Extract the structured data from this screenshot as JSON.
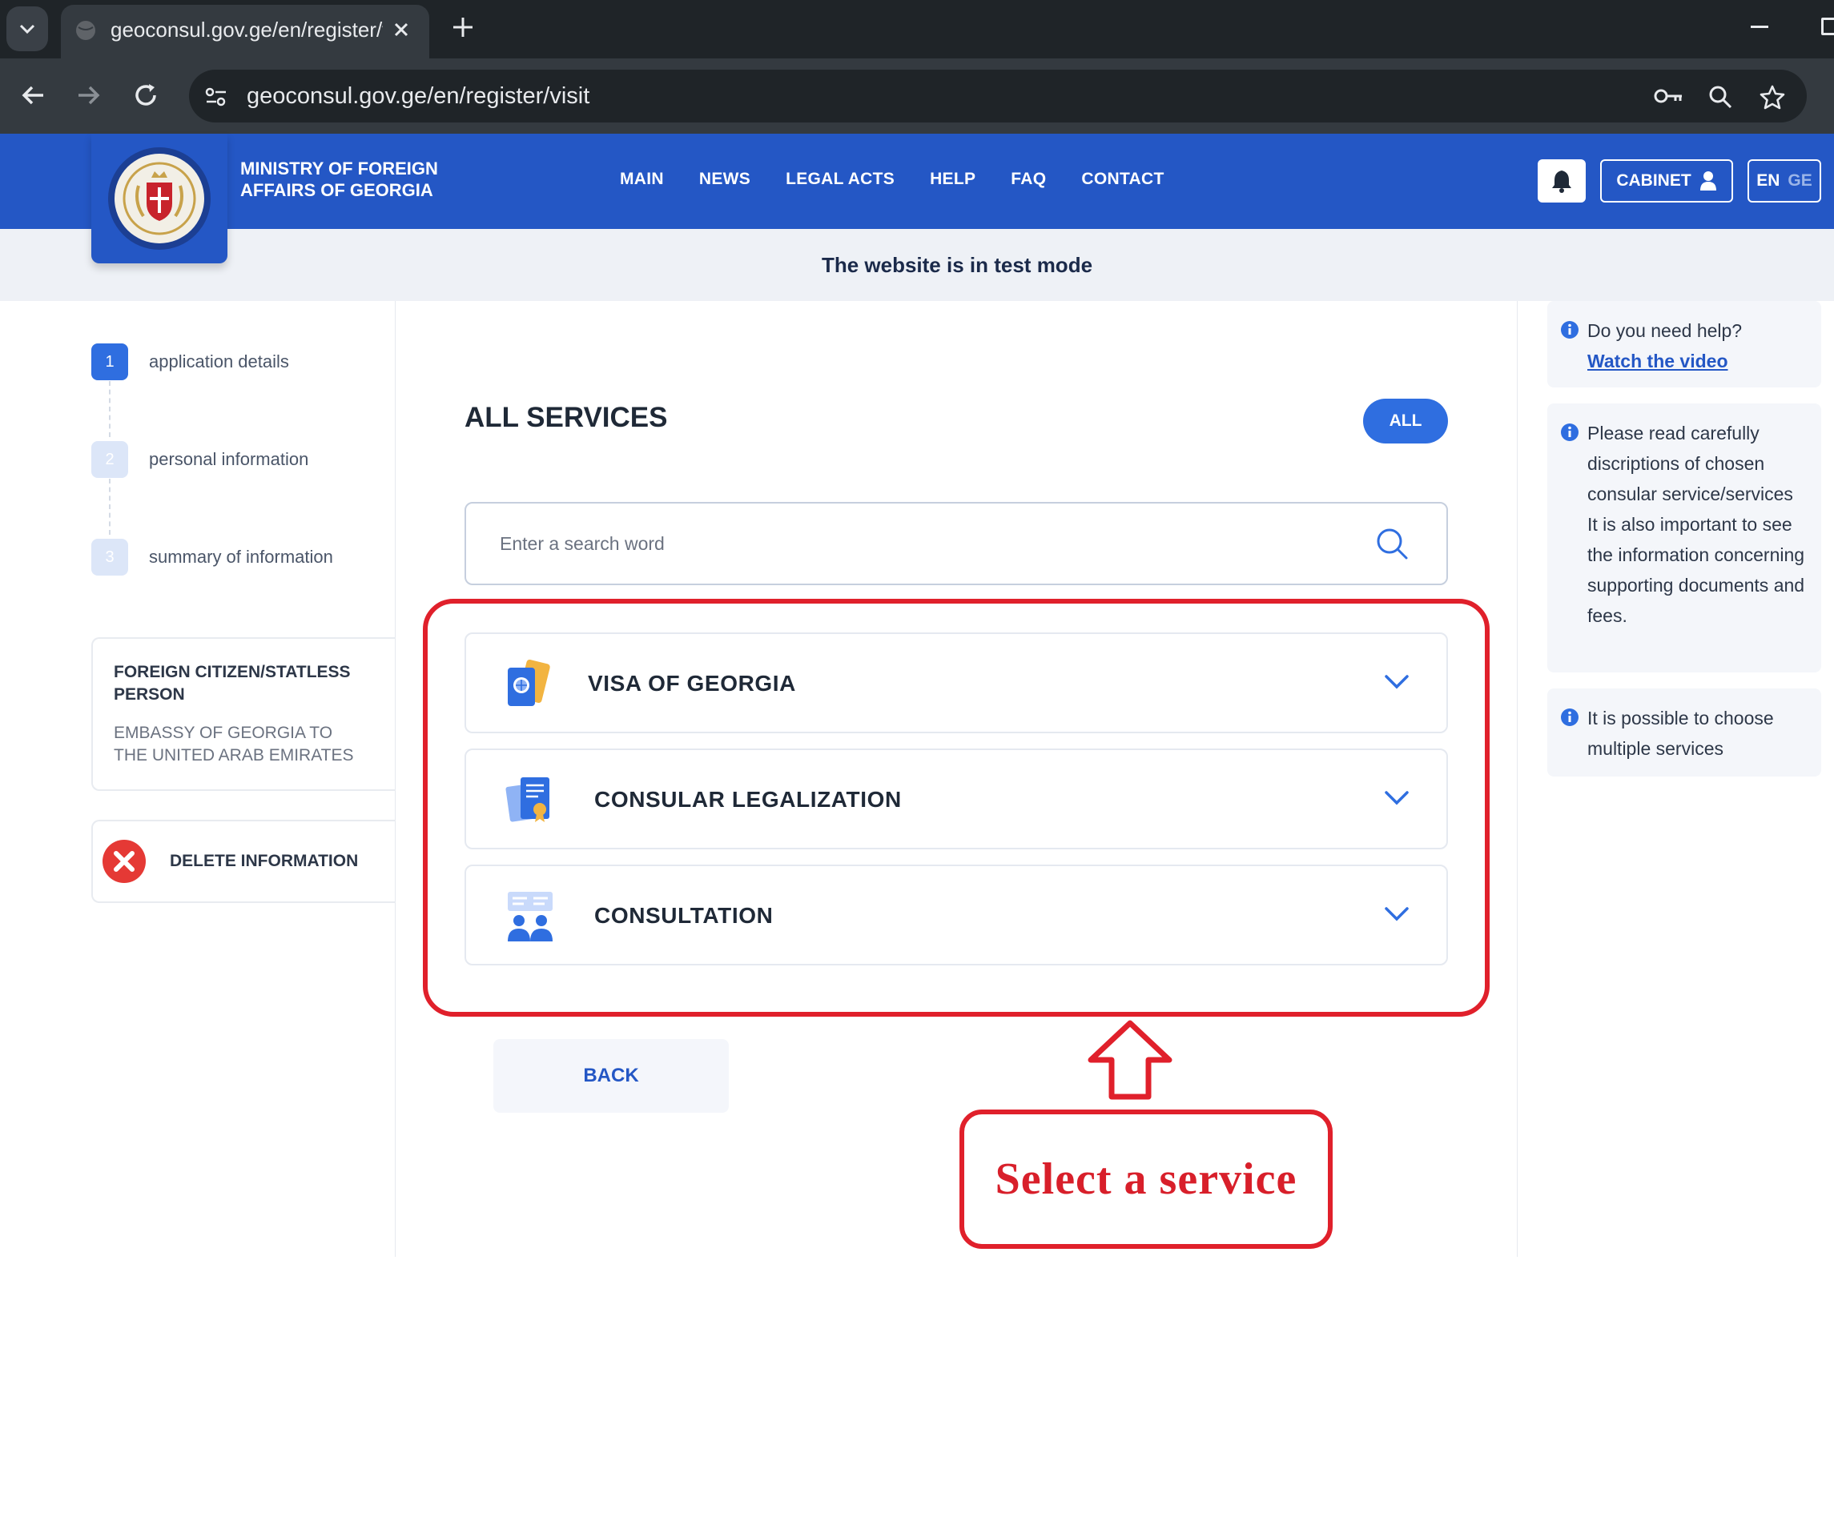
{
  "browser": {
    "tab_title": "geoconsul.gov.ge/en/register/visit",
    "url": "geoconsul.gov.ge/en/register/visit"
  },
  "header": {
    "ministry_line1": "MINISTRY OF FOREIGN",
    "ministry_line2": "AFFAIRS OF GEORGIA",
    "nav": [
      "MAIN",
      "NEWS",
      "LEGAL ACTS",
      "HELP",
      "FAQ",
      "CONTACT"
    ],
    "cabinet_label": "CABINET",
    "lang_en": "EN",
    "lang_ge": "GE",
    "brand_color": "#2457c5"
  },
  "banner": {
    "text": "The website is in test mode"
  },
  "steps": [
    {
      "number": "1",
      "label": "application details",
      "active": true
    },
    {
      "number": "2",
      "label": "personal information",
      "active": false
    },
    {
      "number": "3",
      "label": "summary of information",
      "active": false
    }
  ],
  "applicant": {
    "type": "FOREIGN CITIZEN/STATLESS PERSON",
    "embassy": "EMBASSY OF GEORGIA TO THE UNITED ARAB EMIRATES"
  },
  "delete_label": "DELETE INFORMATION",
  "services": {
    "title": "ALL SERVICES",
    "filter_label": "ALL",
    "search_placeholder": "Enter a search word",
    "items": [
      {
        "label": "VISA OF GEORGIA",
        "icon": "passport-icon"
      },
      {
        "label": "CONSULAR LEGALIZATION",
        "icon": "legalization-document-icon"
      },
      {
        "label": "CONSULTATION",
        "icon": "consultation-people-icon"
      }
    ]
  },
  "back_label": "BACK",
  "annotation": {
    "text": "Select a service",
    "color": "#e0202b"
  },
  "help": {
    "question": "Do you need help?",
    "video_link": "Watch the video",
    "note1": "Please read carefully discriptions of chosen consular service/services It is also important to see the information concerning supporting documents and fees.",
    "note2": "It is possible to choose multiple services"
  }
}
